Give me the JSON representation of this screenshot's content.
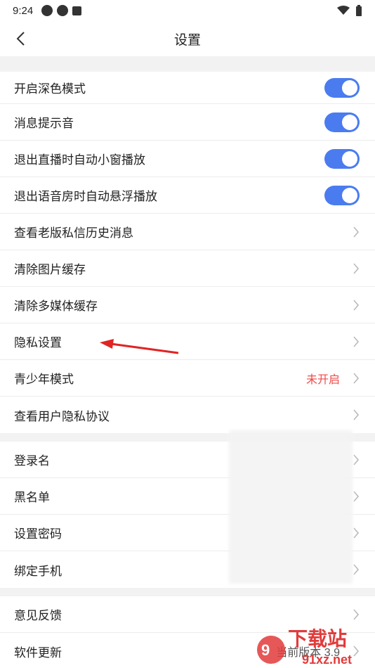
{
  "status": {
    "time": "9:24"
  },
  "header": {
    "title": "设置"
  },
  "group1": [
    {
      "label": "开启深色模式",
      "type": "toggle",
      "on": true
    },
    {
      "label": "消息提示音",
      "type": "toggle",
      "on": true
    },
    {
      "label": "退出直播时自动小窗播放",
      "type": "toggle",
      "on": true
    },
    {
      "label": "退出语音房时自动悬浮播放",
      "type": "toggle",
      "on": true
    },
    {
      "label": "查看老版私信历史消息",
      "type": "link"
    },
    {
      "label": "清除图片缓存",
      "type": "link"
    },
    {
      "label": "清除多媒体缓存",
      "type": "link"
    },
    {
      "label": "隐私设置",
      "type": "link"
    },
    {
      "label": "青少年模式",
      "type": "link",
      "value": "未开启"
    },
    {
      "label": "查看用户隐私协议",
      "type": "link"
    }
  ],
  "group2": [
    {
      "label": "登录名"
    },
    {
      "label": "黑名单"
    },
    {
      "label": "设置密码"
    },
    {
      "label": "绑定手机"
    }
  ],
  "group3": [
    {
      "label": "意见反馈"
    },
    {
      "label": "软件更新",
      "value": "当前版本 3.9"
    }
  ],
  "colors": {
    "accent": "#4a7cf0",
    "warning": "#f04a4a",
    "annotation_arrow": "#e02424"
  },
  "watermark": {
    "text": "下载站",
    "domain": "91xz.net"
  }
}
